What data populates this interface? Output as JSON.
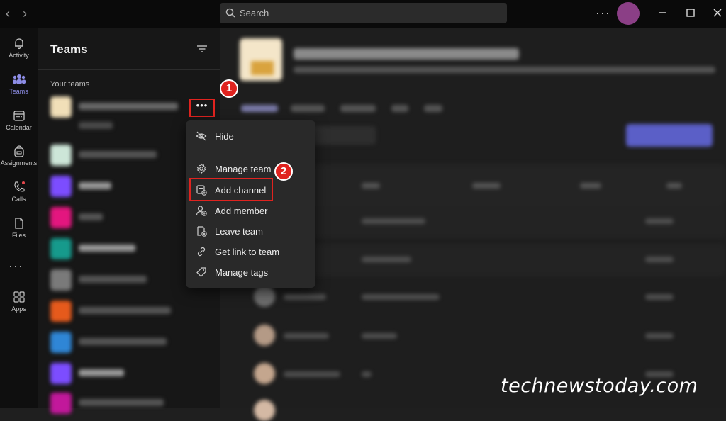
{
  "search": {
    "placeholder": "Search"
  },
  "rail": {
    "activity": "Activity",
    "teams": "Teams",
    "calendar": "Calendar",
    "assignments": "Assignments",
    "calls": "Calls",
    "files": "Files",
    "apps": "Apps"
  },
  "panel": {
    "title": "Teams",
    "section": "Your teams",
    "more_label": "•••"
  },
  "context_menu": {
    "items": [
      {
        "label": "Hide",
        "icon": "eye-off-icon"
      },
      {
        "label": "Manage team",
        "icon": "gear-icon"
      },
      {
        "label": "Add channel",
        "icon": "add-channel-icon"
      },
      {
        "label": "Add member",
        "icon": "add-member-icon"
      },
      {
        "label": "Leave team",
        "icon": "leave-team-icon"
      },
      {
        "label": "Get link to team",
        "icon": "link-icon"
      },
      {
        "label": "Manage tags",
        "icon": "tag-icon"
      }
    ]
  },
  "annotations": {
    "step1": "1",
    "step2": "2",
    "highlight_color": "#e0231f"
  },
  "watermark": "technewstoday.com",
  "colors": {
    "accent": "#5b5fc7",
    "avatar": "#8b3f86",
    "active_rail": "#8d8de6"
  }
}
